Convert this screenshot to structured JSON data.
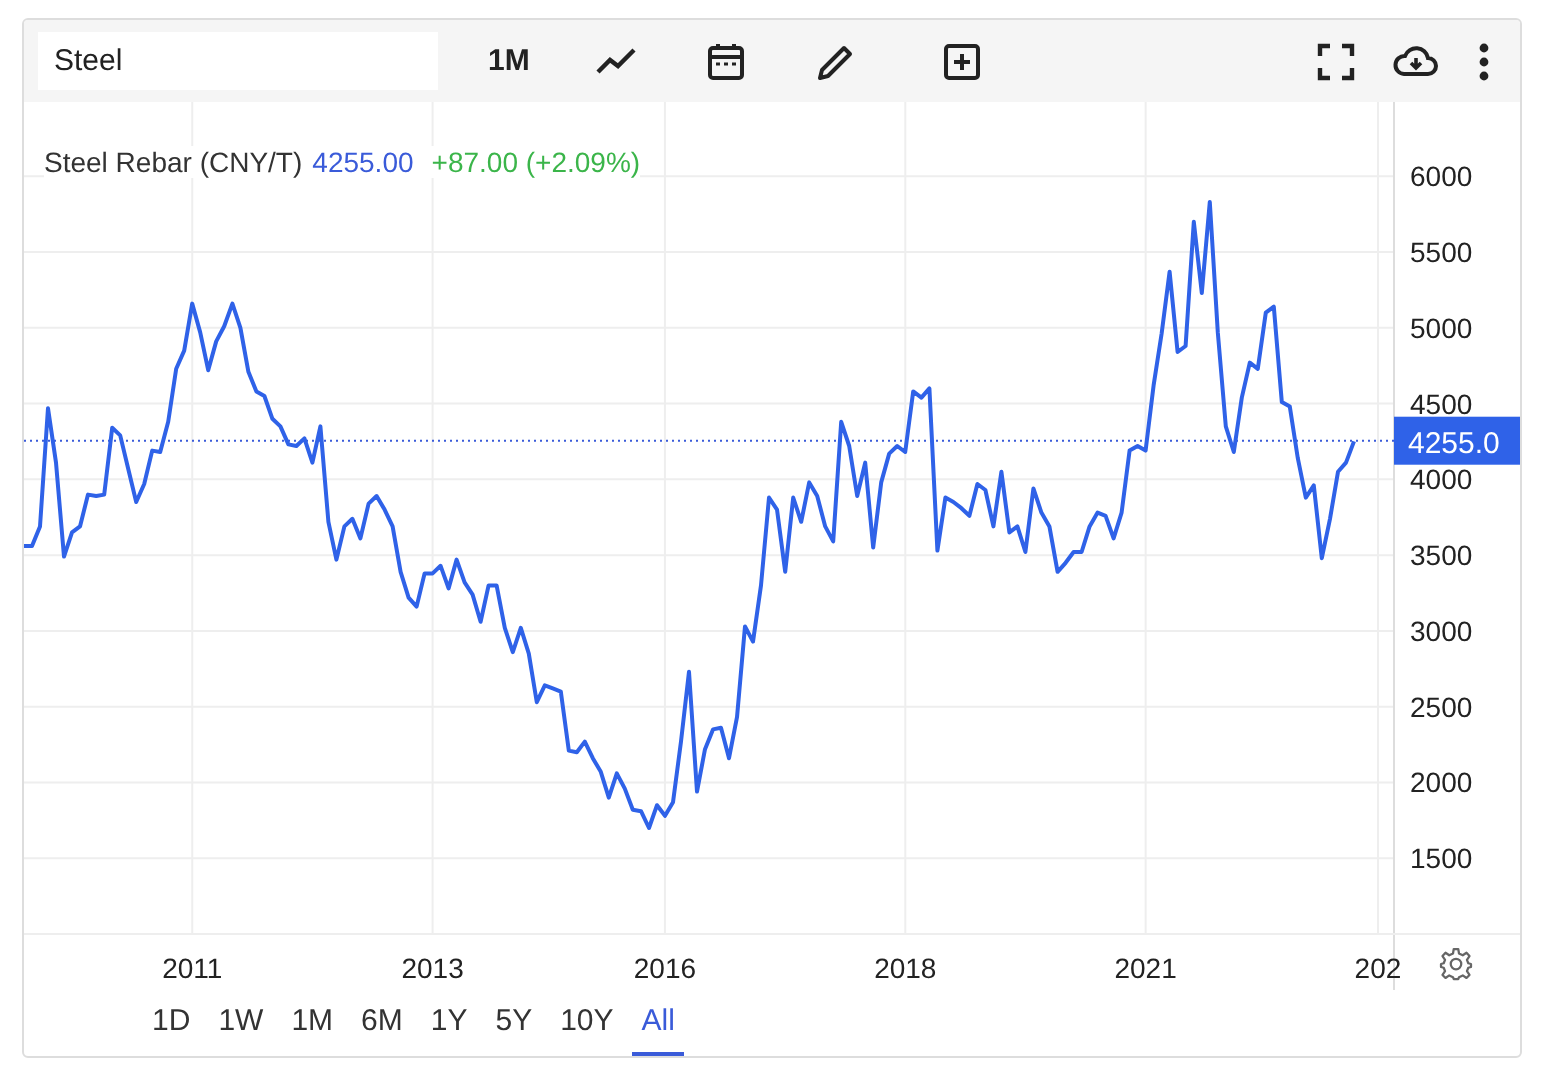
{
  "search": {
    "value": "Steel"
  },
  "toolbar": {
    "interval": "1M"
  },
  "legend": {
    "name": "Steel Rebar (CNY/T)",
    "price": "4255.00",
    "change": "+87.00 (+2.09%)"
  },
  "chart_data": {
    "type": "line",
    "grid": true,
    "ylim": [
      1000,
      6490
    ],
    "categories": [
      null,
      null,
      null,
      null,
      null,
      null,
      null,
      null,
      null,
      null,
      null,
      null,
      null,
      null,
      null,
      null,
      null,
      null,
      null,
      null,
      null,
      "2011",
      null,
      null,
      null,
      null,
      null,
      null,
      null,
      null,
      null,
      null,
      null,
      null,
      null,
      null,
      null,
      null,
      null,
      null,
      null,
      null,
      null,
      null,
      null,
      null,
      null,
      null,
      null,
      null,
      null,
      "2013",
      null,
      null,
      null,
      null,
      null,
      null,
      null,
      null,
      null,
      null,
      null,
      null,
      null,
      null,
      null,
      null,
      null,
      null,
      null,
      null,
      null,
      null,
      null,
      null,
      null,
      null,
      null,
      null,
      "2016",
      null,
      null,
      null,
      null,
      null,
      null,
      null,
      null,
      null,
      null,
      null,
      null,
      null,
      null,
      null,
      null,
      null,
      null,
      null,
      null,
      null,
      null,
      null,
      null,
      null,
      null,
      null,
      null,
      null,
      "2018",
      null,
      null,
      null,
      null,
      null,
      null,
      null,
      null,
      null,
      null,
      null,
      null,
      null,
      null,
      null,
      null,
      null,
      null,
      null,
      null,
      null,
      null,
      null,
      null,
      null,
      null,
      null,
      null,
      null,
      "2021",
      null,
      null,
      null,
      null,
      null,
      null,
      null,
      null,
      null,
      null,
      null,
      null,
      null,
      null,
      null,
      null,
      null,
      null,
      null,
      null,
      null,
      null,
      null,
      null,
      null,
      null,
      null,
      null,
      "202",
      null,
      null
    ],
    "yticks": [
      1500,
      2000,
      2500,
      3000,
      3500,
      4000,
      4500,
      5000,
      5500,
      6000
    ],
    "ref_lines": [
      {
        "axis": "y",
        "value": 4255,
        "label": "4255.0",
        "color": "#3a5bd9"
      }
    ],
    "series": [
      {
        "color": "#2f62e8",
        "values": [
          3560,
          3560,
          3690,
          4470,
          4110,
          3490,
          3650,
          3690,
          3900,
          3890,
          3900,
          4340,
          4290,
          4070,
          3850,
          3970,
          4190,
          4180,
          4380,
          4730,
          4850,
          5160,
          4970,
          4720,
          4910,
          5010,
          5160,
          5000,
          4710,
          4580,
          4550,
          4400,
          4350,
          4230,
          4220,
          4270,
          4110,
          4350,
          3720,
          3470,
          3690,
          3740,
          3610,
          3840,
          3890,
          3800,
          3690,
          3390,
          3220,
          3160,
          3380,
          3380,
          3430,
          3280,
          3470,
          3320,
          3240,
          3060,
          3300,
          3300,
          3020,
          2860,
          3020,
          2850,
          2530,
          2640,
          2620,
          2600,
          2210,
          2200,
          2270,
          2160,
          2070,
          1900,
          2060,
          1960,
          1820,
          1810,
          1700,
          1850,
          1780,
          1870,
          2270,
          2730,
          1940,
          2220,
          2350,
          2360,
          2160,
          2430,
          3030,
          2930,
          3300,
          3880,
          3800,
          3390,
          3880,
          3720,
          3980,
          3890,
          3690,
          3590,
          4380,
          4220,
          3890,
          4110,
          3550,
          3980,
          4170,
          4220,
          4180,
          4580,
          4540,
          4600,
          3530,
          3880,
          3850,
          3810,
          3760,
          3970,
          3930,
          3690,
          4050,
          3650,
          3690,
          3520,
          3940,
          3780,
          3690,
          3390,
          3450,
          3520,
          3520,
          3690,
          3780,
          3760,
          3610,
          3780,
          4190,
          4220,
          4190,
          4620,
          4960,
          5370,
          4840,
          4880,
          5700,
          5230,
          5830,
          4970,
          4350,
          4180,
          4540,
          4770,
          4730,
          5100,
          5140,
          4510,
          4480,
          4140,
          3880,
          3960,
          3480,
          3740,
          4050,
          4110,
          4250,
          null,
          null,
          null,
          null,
          null
        ]
      }
    ]
  },
  "ranges": [
    {
      "label": "1D",
      "selected": false
    },
    {
      "label": "1W",
      "selected": false
    },
    {
      "label": "1M",
      "selected": false
    },
    {
      "label": "6M",
      "selected": false
    },
    {
      "label": "1Y",
      "selected": false
    },
    {
      "label": "5Y",
      "selected": false
    },
    {
      "label": "10Y",
      "selected": false
    },
    {
      "label": "All",
      "selected": true
    }
  ]
}
